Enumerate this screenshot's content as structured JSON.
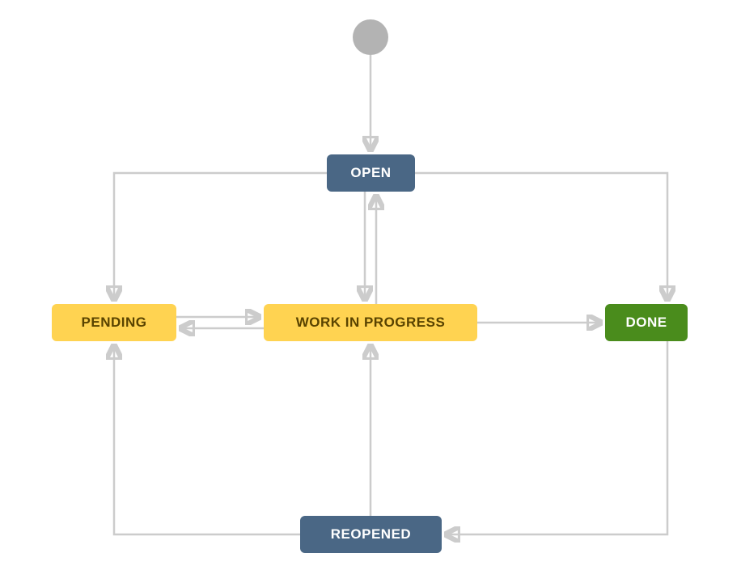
{
  "nodes": {
    "open": {
      "label": "OPEN",
      "color": "blue"
    },
    "pending": {
      "label": "PENDING",
      "color": "yellow"
    },
    "work_in_progress": {
      "label": "WORK IN PROGRESS",
      "color": "yellow"
    },
    "done": {
      "label": "DONE",
      "color": "green"
    },
    "reopened": {
      "label": "REOPENED",
      "color": "blue"
    }
  },
  "start_node": "start",
  "edges": [
    {
      "from": "start",
      "to": "open"
    },
    {
      "from": "open",
      "to": "pending"
    },
    {
      "from": "open",
      "to": "work_in_progress"
    },
    {
      "from": "work_in_progress",
      "to": "open"
    },
    {
      "from": "open",
      "to": "done"
    },
    {
      "from": "pending",
      "to": "work_in_progress"
    },
    {
      "from": "work_in_progress",
      "to": "pending"
    },
    {
      "from": "work_in_progress",
      "to": "done"
    },
    {
      "from": "reopened",
      "to": "pending"
    },
    {
      "from": "reopened",
      "to": "work_in_progress"
    },
    {
      "from": "done",
      "to": "reopened"
    }
  ],
  "palette": {
    "blue": "#4a6785",
    "yellow": "#ffd351",
    "yellow_text": "#594300",
    "green": "#4a8c1c",
    "arrow": "#cccccc",
    "start_circle": "#b3b3b3"
  }
}
